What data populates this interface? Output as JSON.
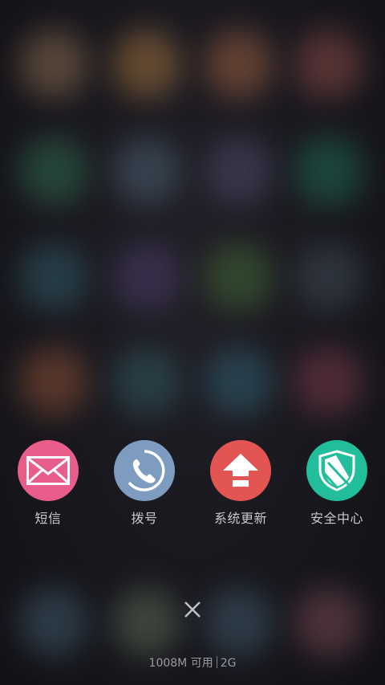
{
  "background": {
    "base_color": "#18171d",
    "blurred_icon_colors": [
      [
        "#8a6a4f",
        "#a0723f",
        "#9a6040",
        "#8a4a45"
      ],
      [
        "#2f6a4e",
        "#4a6070",
        "#4e4a6a",
        "#1f6a55"
      ],
      [
        "#2f5a66",
        "#4a3e6a",
        "#3f6a35",
        "#3e4a55"
      ],
      [
        "#8a4f35",
        "#2f5a60",
        "#2f6070",
        "#7a3a4a"
      ],
      [
        "#3e5a6a",
        "#5a6a55",
        "#3f5a6a",
        "#7a4a55"
      ]
    ]
  },
  "actions": [
    {
      "label": "短信",
      "icon": "envelope-icon",
      "color": "#e95d8b"
    },
    {
      "label": "拨号",
      "icon": "phone-icon",
      "color": "#7d9cc0"
    },
    {
      "label": "系统更新",
      "icon": "upload-arrow-icon",
      "color": "#e35552"
    },
    {
      "label": "安全中心",
      "icon": "shield-icon",
      "color": "#22bd9b"
    }
  ],
  "close": {
    "icon": "close-icon",
    "color": "#c2c1c6"
  },
  "memory": {
    "available": "1008M 可用",
    "total": "2G"
  }
}
